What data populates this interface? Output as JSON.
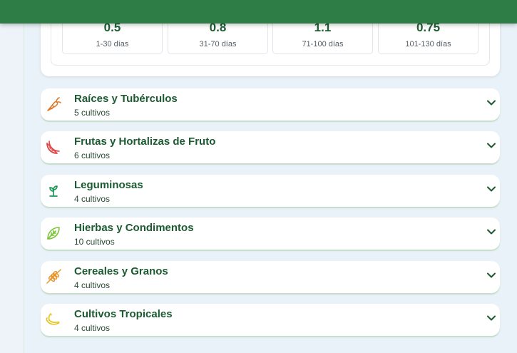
{
  "stages": [
    {
      "kc": "0.5",
      "range": "1-30 días"
    },
    {
      "kc": "0.8",
      "range": "31-70 días"
    },
    {
      "kc": "1.1",
      "range": "71-100 días"
    },
    {
      "kc": "0.75",
      "range": "101-130 días"
    }
  ],
  "categories": [
    {
      "name": "Raíces y Tubérculos",
      "count": "5 cultivos",
      "icon": "carrot-icon",
      "color": "#e07a2a"
    },
    {
      "name": "Frutas y Hortalizas de Fruto",
      "count": "6 cultivos",
      "icon": "watermelon-icon",
      "color": "#e04848"
    },
    {
      "name": "Leguminosas",
      "count": "4 cultivos",
      "icon": "sprout-icon",
      "color": "#1f9a5b"
    },
    {
      "name": "Hierbas y Condimentos",
      "count": "10 cultivos",
      "icon": "leaf-icon",
      "color": "#7cc43a"
    },
    {
      "name": "Cereales y Granos",
      "count": "4 cultivos",
      "icon": "wheat-icon",
      "color": "#e8962e"
    },
    {
      "name": "Cultivos Tropicales",
      "count": "4 cultivos",
      "icon": "banana-icon",
      "color": "#e8c21c"
    }
  ],
  "colors": {
    "header": "#2e7d46",
    "title_text": "#1c5a31",
    "chevron": "#1c5a31"
  }
}
